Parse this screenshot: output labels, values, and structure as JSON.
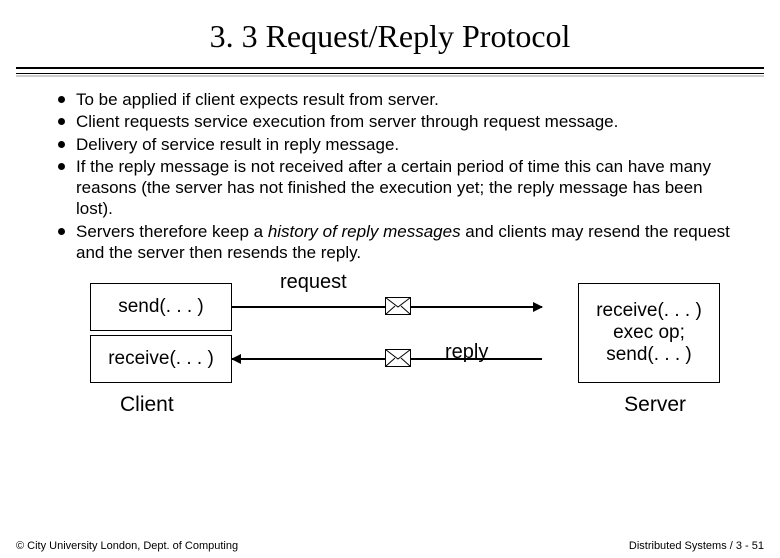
{
  "title": "3. 3 Request/Reply Protocol",
  "bullets": {
    "b0": "To be applied if client expects result from server.",
    "b1": "Client requests service execution from server through request message.",
    "b2": "Delivery of service result in reply message.",
    "b3": "If the reply message is not received after a certain period of time this can have many reasons (the server has not finished the execution yet; the reply message has been lost).",
    "b4_pre": "Servers therefore keep a ",
    "b4_em": "history of reply messages",
    "b4_post": " and clients may resend the request and the server then resends the reply."
  },
  "diagram": {
    "client_send": "send(. . . )",
    "client_recv": "receive(. . . )",
    "server_recv": "receive(. . . )",
    "server_exec": "exec op;",
    "server_send": "send(. . . )",
    "request_label": "request",
    "reply_label": "reply",
    "client_label": "Client",
    "server_label": "Server"
  },
  "footer": {
    "left": "© City University London, Dept. of Computing",
    "right": "Distributed Systems / 3 - 51"
  }
}
